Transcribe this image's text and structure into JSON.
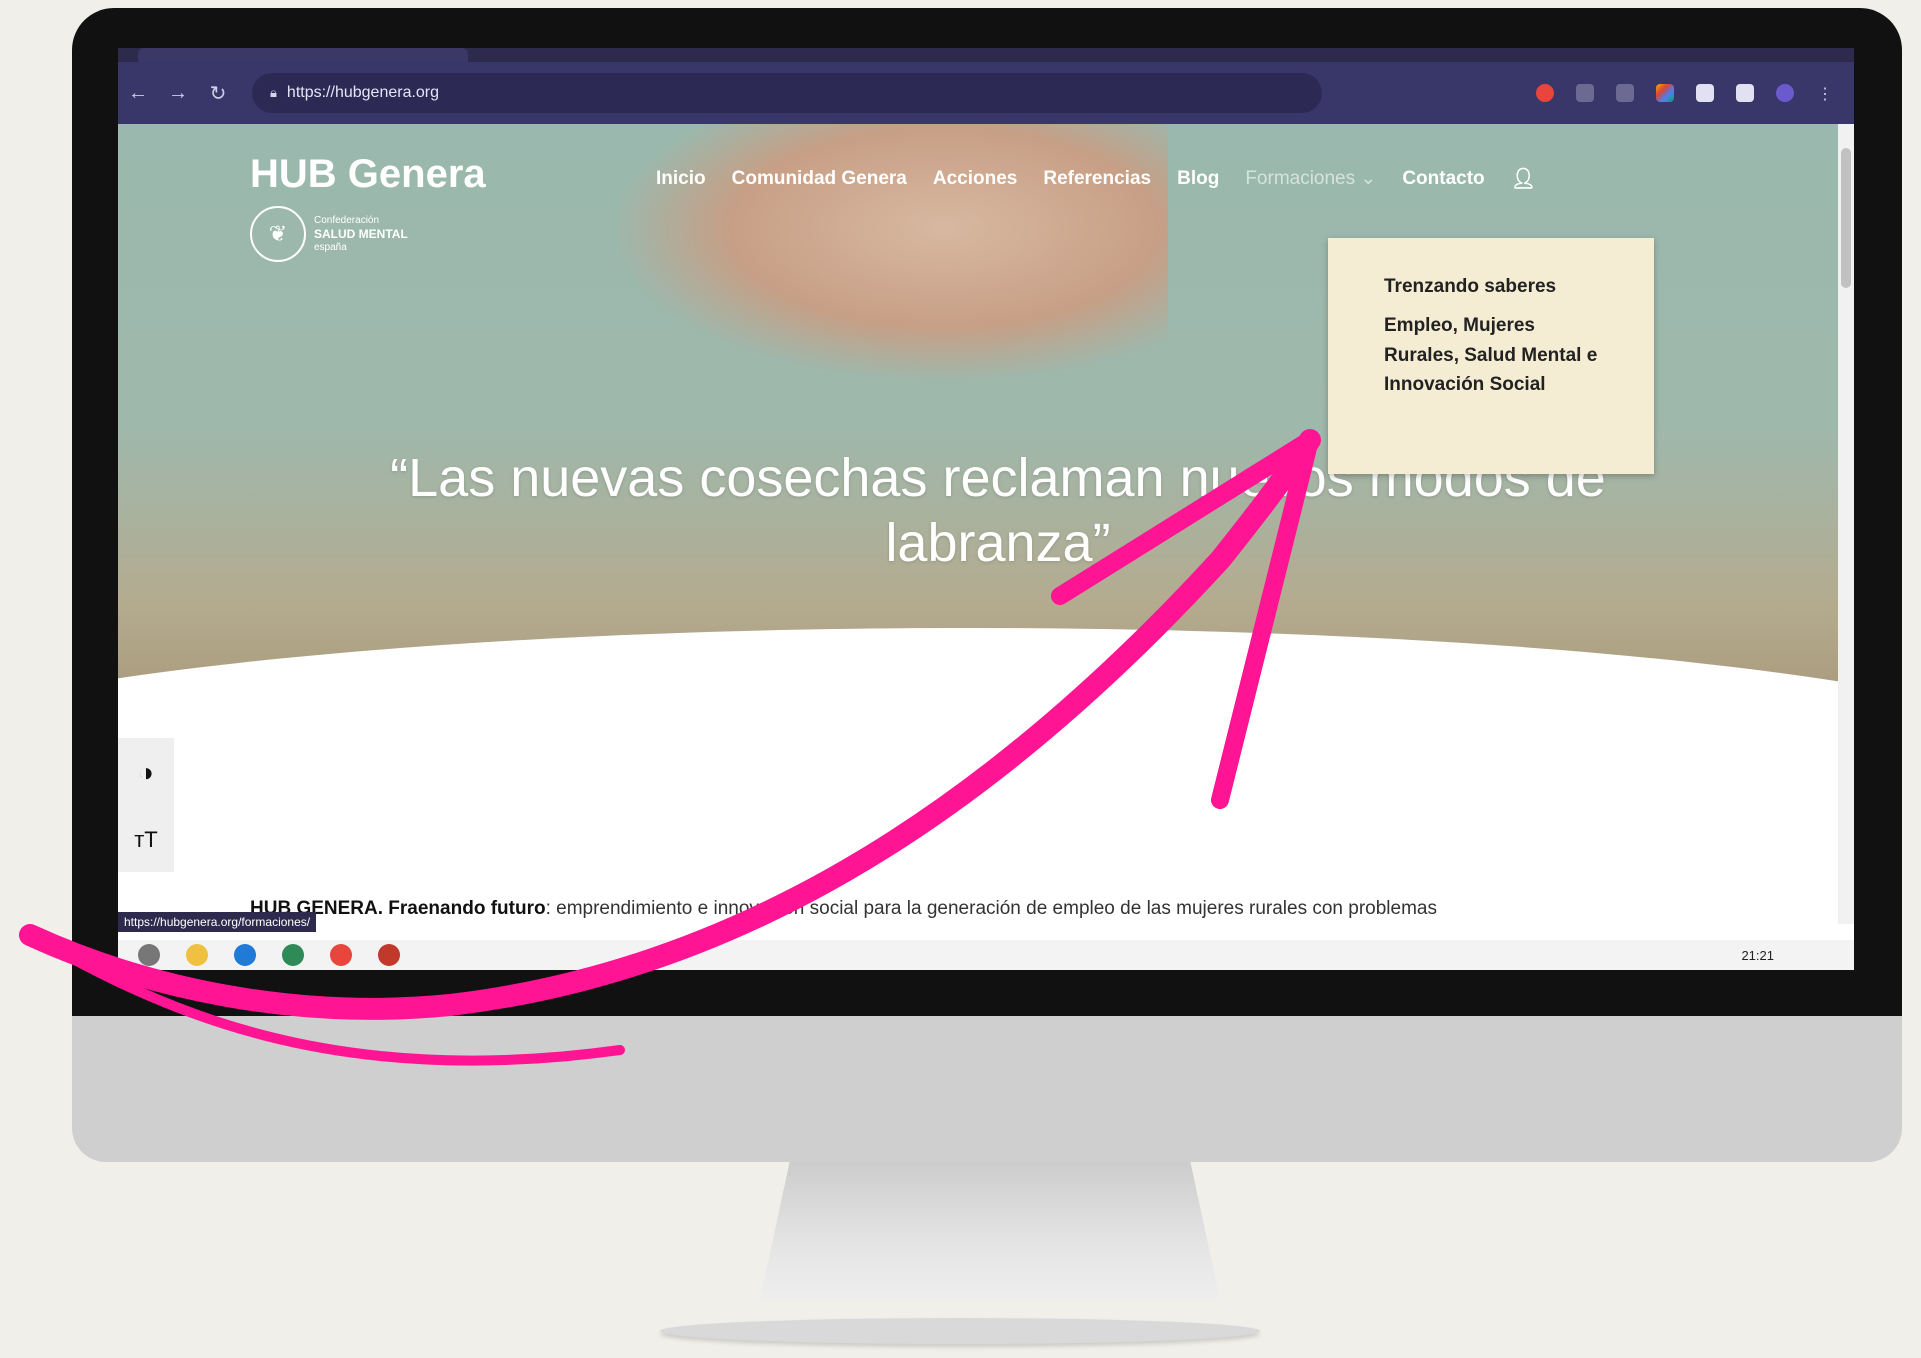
{
  "browser": {
    "url": "https://hubgenera.org",
    "status_url": "https://hubgenera.org/formaciones/"
  },
  "site": {
    "logo": "HUB Genera",
    "confed_top": "Confederación",
    "confed_mid": "SALUD MENTAL",
    "confed_bot": "españa"
  },
  "nav": {
    "items": [
      "Inicio",
      "Comunidad Genera",
      "Acciones",
      "Referencias",
      "Blog",
      "Formaciones ⌄",
      "Contacto"
    ]
  },
  "dropdown": {
    "items": [
      "Trenzando saberes",
      "Empleo, Mujeres Rurales, Salud Mental e Innovación Social"
    ]
  },
  "hero": {
    "quote": "“Las nuevas cosechas reclaman nuevos modos de labranza”"
  },
  "body": {
    "strong1": "HUB GENERA.",
    "strong2": "Fraenando futuro",
    "rest": ": emprendimiento e innovación social para la generación de empleo de las mujeres rurales con problemas"
  },
  "taskbar": {
    "time": "21:21"
  },
  "colors": {
    "arrow": "#ff1493",
    "browser_bar": "#39366a",
    "dropdown_bg": "#f4ecd3"
  },
  "icons": [
    "back-icon",
    "forward-icon",
    "reload-icon",
    "lock-icon",
    "user-icon",
    "contrast-icon",
    "text-size-icon"
  ]
}
